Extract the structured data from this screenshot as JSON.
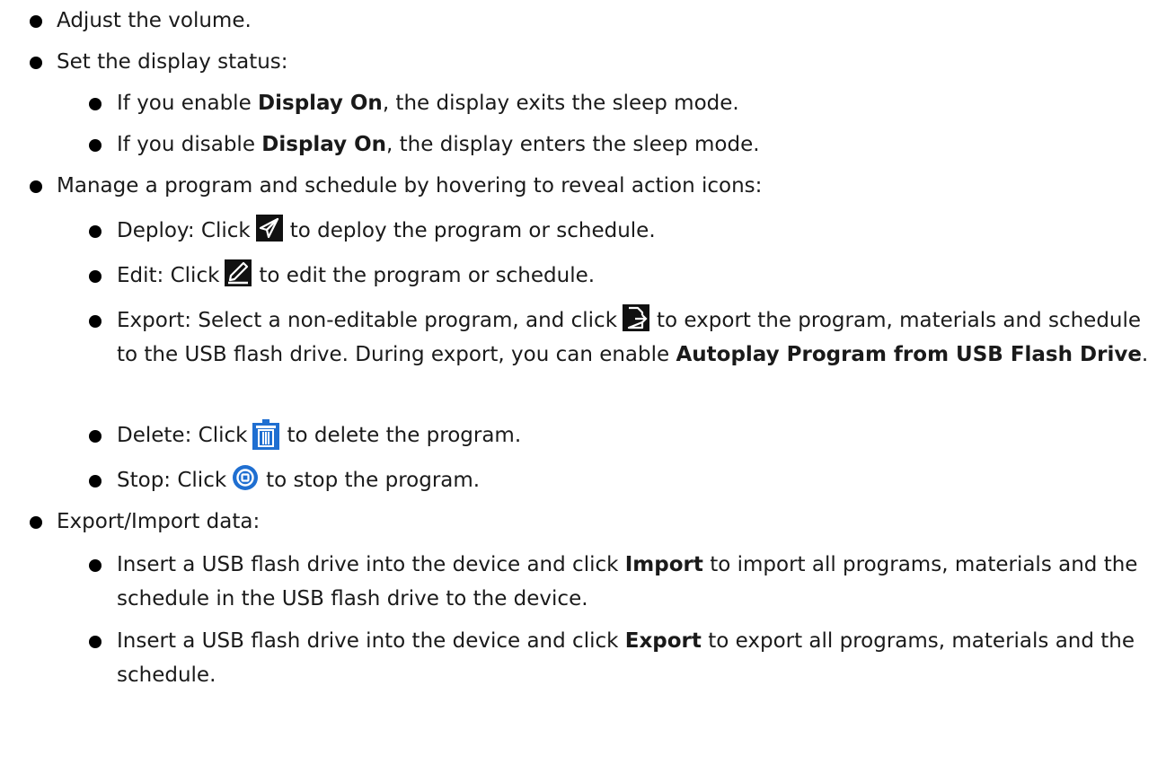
{
  "items": {
    "volume": "Adjust the volume.",
    "display_status": "Set the display status:",
    "display_on_1_pre": "If you enable ",
    "display_on_1_bold": "Display On",
    "display_on_1_post": ", the display exits the sleep mode.",
    "display_on_2_pre": "If you disable ",
    "display_on_2_bold": "Display On",
    "display_on_2_post": ", the display enters the sleep mode.",
    "manage": "Manage a program and schedule by hovering to reveal action icons:",
    "deploy_pre": "Deploy: Click",
    "deploy_post": "to deploy the program or schedule.",
    "edit_pre": "Edit: Click",
    "edit_post": "to edit the program or schedule.",
    "export_pre": "Export: Select a non-editable program, and click",
    "export_post": "to export the program, materials and schedule to the USB flash drive. During export, you can enable ",
    "export_bold": "Autoplay Program from USB Flash Drive",
    "export_end": ".",
    "delete_pre": "Delete: Click",
    "delete_post": "to delete the program.",
    "stop_pre": "Stop: Click",
    "stop_post": "to stop the program.",
    "export_import": "Export/Import data:",
    "import_pre": "Insert a USB flash drive into the device and click ",
    "import_bold": "Import",
    "import_post": " to import all programs, materials and the schedule in the USB flash drive to the device.",
    "export_all_pre": "Insert a USB flash drive into the device and click ",
    "export_all_bold": "Export",
    "export_all_post": " to export all programs, materials and the schedule."
  },
  "icons": {
    "deploy": "paper-plane-icon",
    "edit": "pencil-icon",
    "export": "export-file-icon",
    "delete": "trash-icon",
    "stop": "stop-circle-icon"
  }
}
